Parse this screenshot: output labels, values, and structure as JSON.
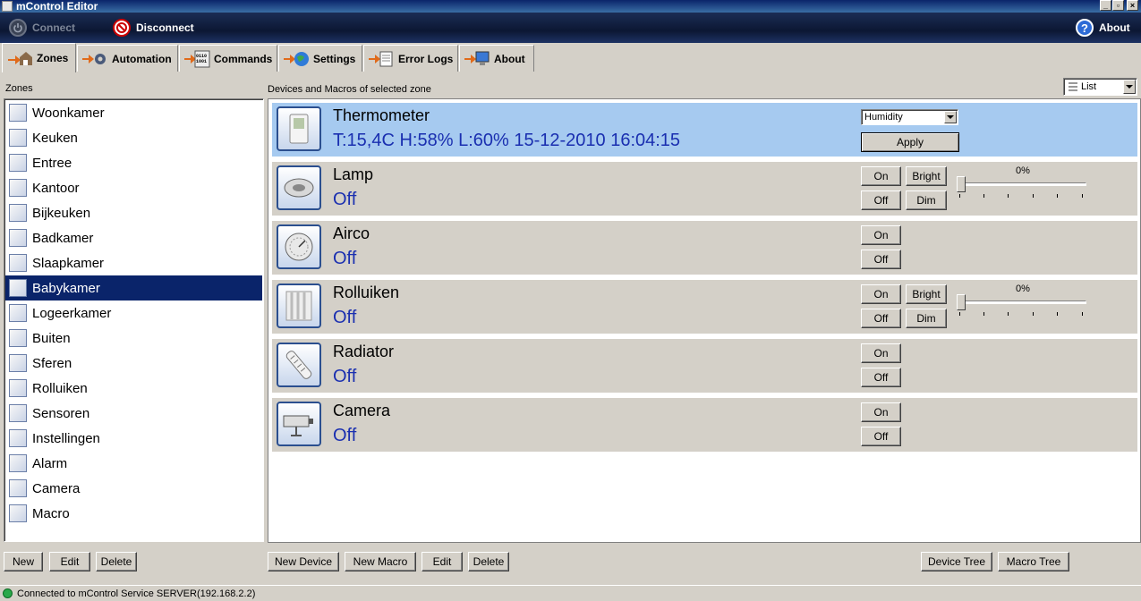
{
  "window": {
    "title": "mControl Editor"
  },
  "header": {
    "connect_label": "Connect",
    "disconnect_label": "Disconnect",
    "about_label": "About"
  },
  "tabs": [
    {
      "label": "Zones",
      "icon": "zones-icon",
      "active": true
    },
    {
      "label": "Automation",
      "icon": "gear-icon"
    },
    {
      "label": "Commands",
      "icon": "commands-icon"
    },
    {
      "label": "Settings",
      "icon": "globe-icon"
    },
    {
      "label": "Error Logs",
      "icon": "log-icon"
    },
    {
      "label": "About",
      "icon": "computer-icon"
    }
  ],
  "zones": {
    "heading": "Zones",
    "items": [
      "Woonkamer",
      "Keuken",
      "Entree",
      "Kantoor",
      "Bijkeuken",
      "Badkamer",
      "Slaapkamer",
      "Babykamer",
      "Logeerkamer",
      "Buiten",
      "Sferen",
      "Rolluiken",
      "Sensoren",
      "Instellingen",
      "Alarm",
      "Camera",
      "Macro"
    ],
    "selected": "Babykamer",
    "new_label": "New",
    "edit_label": "Edit",
    "delete_label": "Delete"
  },
  "devices": {
    "heading": "Devices and Macros of selected zone",
    "view_mode": "List",
    "items": [
      {
        "name": "Thermometer",
        "status": "T:15,4C H:58% L:60%  15-12-2010 16:04:15",
        "kind": "sensor",
        "combo": "Humidity",
        "apply_label": "Apply"
      },
      {
        "name": "Lamp",
        "status": "Off",
        "kind": "dimmer",
        "on": "On",
        "off": "Off",
        "bright": "Bright",
        "dim": "Dim",
        "level": "0%",
        "level_value": 0
      },
      {
        "name": "Airco",
        "status": "Off",
        "kind": "switch",
        "on": "On",
        "off": "Off"
      },
      {
        "name": "Rolluiken",
        "status": "Off",
        "kind": "dimmer",
        "on": "On",
        "off": "Off",
        "bright": "Bright",
        "dim": "Dim",
        "level": "0%",
        "level_value": 0
      },
      {
        "name": "Radiator",
        "status": "Off",
        "kind": "switch",
        "on": "On",
        "off": "Off"
      },
      {
        "name": "Camera",
        "status": "Off",
        "kind": "switch",
        "on": "On",
        "off": "Off"
      }
    ],
    "new_device_label": "New Device",
    "new_macro_label": "New Macro",
    "edit_label": "Edit",
    "delete_label": "Delete",
    "device_tree_label": "Device Tree",
    "macro_tree_label": "Macro Tree"
  },
  "status": {
    "text": "Connected to mControl Service SERVER(192.168.2.2)"
  },
  "colors": {
    "selection": "#0a246a",
    "device_selected": "#a6caf0",
    "status_text": "#1a2fb0"
  }
}
